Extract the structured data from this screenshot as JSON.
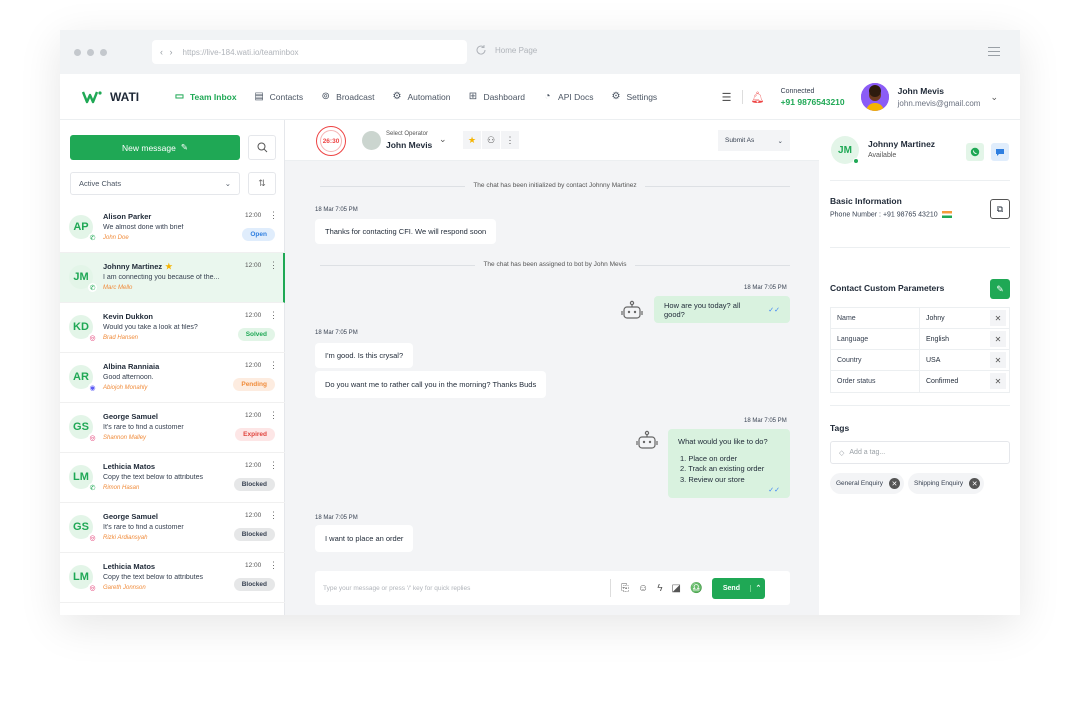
{
  "browser": {
    "url": "https://live-184.wati.io/teaminbox",
    "reload_label": "Home Page"
  },
  "nav": {
    "logo_text": "WATI",
    "items": [
      {
        "label": "Team Inbox",
        "icon": "inbox-icon"
      },
      {
        "label": "Contacts",
        "icon": "contacts-icon"
      },
      {
        "label": "Broadcast",
        "icon": "broadcast-icon"
      },
      {
        "label": "Automation",
        "icon": "automation-icon"
      },
      {
        "label": "Dashboard",
        "icon": "dashboard-icon"
      },
      {
        "label": "API Docs",
        "icon": "api-icon"
      },
      {
        "label": "Settings",
        "icon": "gear-icon"
      }
    ],
    "connected_label": "Connected",
    "connected_phone": "+91 9876543210",
    "user_name": "John Mevis",
    "user_email": "john.mevis@gmail.com"
  },
  "left": {
    "new_message_label": "New message",
    "filter_label": "Active Chats",
    "chats": [
      {
        "initials": "AP",
        "name": "Alison Parker",
        "message": "We almost done with brief",
        "agent": "John Doe",
        "time": "12:00",
        "status": "Open",
        "status_class": "st-open",
        "channel": "whatsapp",
        "starred": false
      },
      {
        "initials": "JM",
        "name": "Johnny Martinez",
        "message": "I am connecting you because of the...",
        "agent": "Marc Mello",
        "time": "12:00",
        "status": "",
        "status_class": "",
        "channel": "whatsapp",
        "starred": true
      },
      {
        "initials": "KD",
        "name": "Kevin Dukkon",
        "message": "Would you take a look at files?",
        "agent": "Brad Hansen",
        "time": "12:00",
        "status": "Solved",
        "status_class": "st-solved",
        "channel": "instagram",
        "starred": false
      },
      {
        "initials": "AR",
        "name": "Albina Ranniaia",
        "message": "Good afternoon.",
        "agent": "Abiojoh Monahly",
        "time": "12:00",
        "status": "Pending",
        "status_class": "st-pending",
        "channel": "messenger",
        "starred": false
      },
      {
        "initials": "GS",
        "name": "George Samuel",
        "message": "It's rare to find a customer",
        "agent": "Shannon Malley",
        "time": "12:00",
        "status": "Expired",
        "status_class": "st-expired",
        "channel": "instagram",
        "starred": false
      },
      {
        "initials": "LM",
        "name": "Lethicia Matos",
        "message": "Copy the text below to attributes",
        "agent": "Rimon Hasan",
        "time": "12:00",
        "status": "Blocked",
        "status_class": "st-blocked",
        "channel": "whatsapp",
        "starred": false
      },
      {
        "initials": "GS",
        "name": "George Samuel",
        "message": "It's rare to find a customer",
        "agent": "Rizki Ardiansyah",
        "time": "12:00",
        "status": "Blocked",
        "status_class": "st-blocked",
        "channel": "instagram",
        "starred": false
      },
      {
        "initials": "LM",
        "name": "Lethicia Matos",
        "message": "Copy the text below to attributes",
        "agent": "Gareth Jonnson",
        "time": "12:00",
        "status": "Blocked",
        "status_class": "st-blocked",
        "channel": "instagram",
        "starred": false
      }
    ]
  },
  "chat": {
    "timer": "26:30",
    "operator_label": "Select Operator",
    "operator_name": "John Mevis",
    "submit_as_label": "Submit As",
    "sys_init": "The chat has been initialized by contact Johnny Martinez",
    "sys_assigned": "The chat has been assigned to bot by John Mevis",
    "ts": "18 Mar  7:05 PM",
    "msg1": "Thanks for contacting CFI. We will respond soon",
    "msg2": "How are you today? all good?",
    "msg3": "I'm good. Is this crysal?",
    "msg4": "Do you want me to rather call you in the morning? Thanks Buds",
    "msg5_title": "What would you like to do?",
    "msg5_options": [
      "1.  Place on order",
      "2.  Track an existing order",
      "3.  Review our store"
    ],
    "msg6": "I want to place an order",
    "composer_placeholder": "Type your message or press '/' key for quick replies",
    "send_label": "Send"
  },
  "contact": {
    "initials": "JM",
    "name": "Johnny Martinez",
    "status": "Available",
    "basic_info_title": "Basic Information",
    "phone_label": "Phone Number :",
    "phone": "+91 98765 43210",
    "params_title": "Contact Custom Parameters",
    "params": [
      {
        "key": "Name",
        "value": "Johny"
      },
      {
        "key": "Language",
        "value": "English"
      },
      {
        "key": "Country",
        "value": "USA"
      },
      {
        "key": "Order status",
        "value": "Confirmed"
      }
    ],
    "tags_title": "Tags",
    "tag_placeholder": "Add a tag...",
    "tags": [
      "General Enquiry",
      "Shipping Enquiry"
    ]
  },
  "colors": {
    "accent": "#1fa855",
    "bubble_out": "#d9f2df",
    "status_open": "#2f7fe0",
    "status_pending": "#f08b3a",
    "status_expired": "#e0433c"
  }
}
